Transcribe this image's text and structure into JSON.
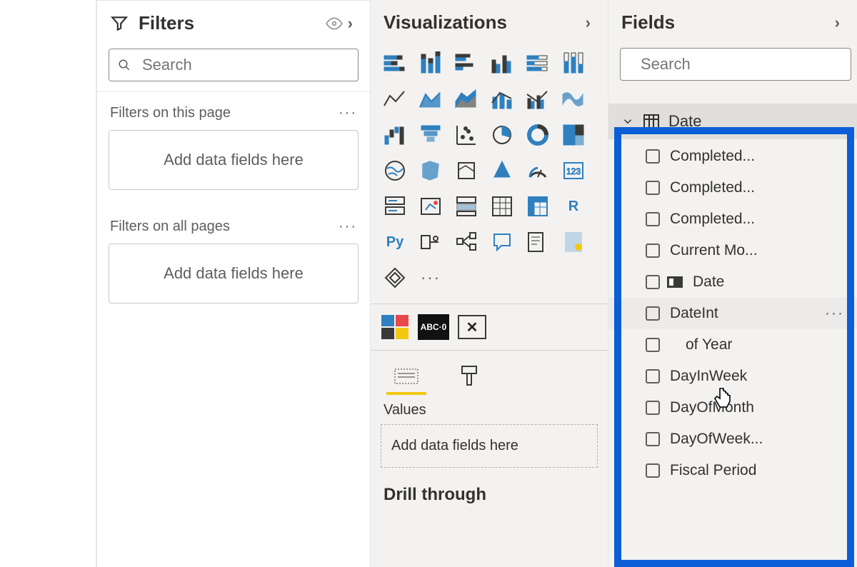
{
  "filters": {
    "title": "Filters",
    "search_placeholder": "Search",
    "page_label": "Filters on this page",
    "allpages_label": "Filters on all pages",
    "drop_text": "Add data fields here"
  },
  "viz": {
    "title": "Visualizations",
    "values_label": "Values",
    "drop_text": "Add data fields here",
    "drill_label": "Drill through"
  },
  "fields": {
    "title": "Fields",
    "search_placeholder": "Search",
    "table_name": "Date",
    "items": [
      {
        "label": "Completed...",
        "hasHier": false,
        "hover": false
      },
      {
        "label": "Completed...",
        "hasHier": false,
        "hover": false
      },
      {
        "label": "Completed...",
        "hasHier": false,
        "hover": false
      },
      {
        "label": "Current Mo...",
        "hasHier": false,
        "hover": false
      },
      {
        "label": "Date",
        "hasHier": true,
        "hover": false
      },
      {
        "label": "DateInt",
        "hasHier": false,
        "hover": true
      },
      {
        "label": "of Year",
        "hasHier": false,
        "hover": false,
        "indented": true
      },
      {
        "label": "DayInWeek",
        "hasHier": false,
        "hover": false
      },
      {
        "label": "DayOfMonth",
        "hasHier": false,
        "hover": false
      },
      {
        "label": "DayOfWeek...",
        "hasHier": false,
        "hover": false
      },
      {
        "label": "Fiscal Period",
        "hasHier": false,
        "hover": false
      }
    ]
  }
}
